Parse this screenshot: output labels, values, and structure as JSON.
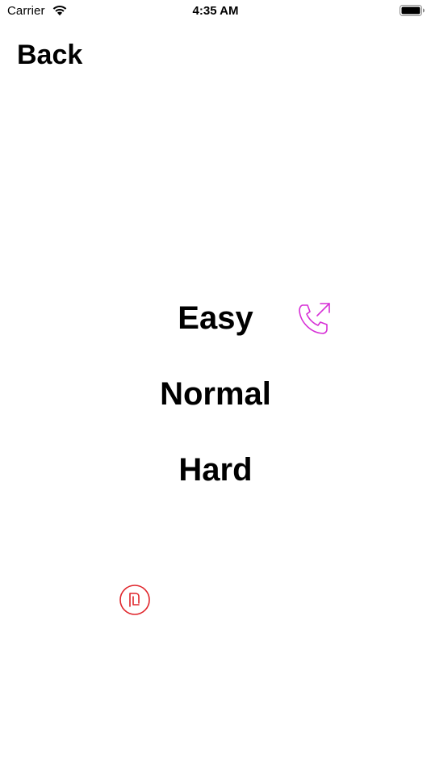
{
  "status_bar": {
    "carrier": "Carrier",
    "time": "4:35 AM",
    "wifi_icon": "wifi-icon",
    "battery_icon": "battery-icon"
  },
  "nav": {
    "back_label": "Back"
  },
  "difficulty": {
    "options": [
      "Easy",
      "Normal",
      "Hard"
    ]
  },
  "icons": {
    "phone": {
      "name": "phone-outgoing-icon",
      "color": "#d62fd6"
    },
    "shekel": {
      "name": "shekel-circle-icon",
      "color": "#e0252b"
    }
  }
}
